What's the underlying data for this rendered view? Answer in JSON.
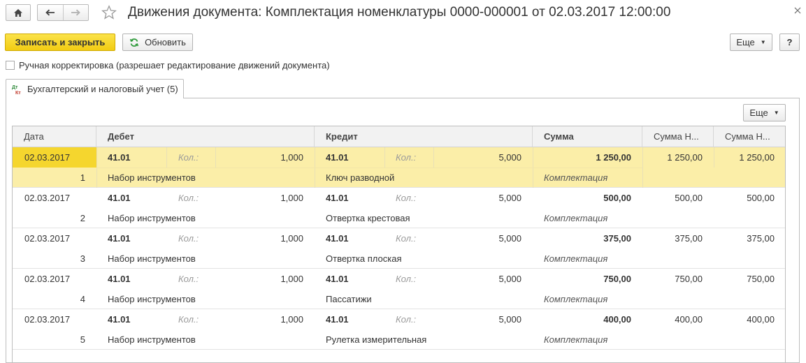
{
  "window": {
    "title": "Движения документа: Комплектация номенклатуры 0000-000001 от 02.03.2017 12:00:00"
  },
  "toolbar": {
    "save_close_label": "Записать и закрыть",
    "refresh_label": "Обновить",
    "more_label": "Еще",
    "help_label": "?"
  },
  "manual_edit": {
    "label": "Ручная корректировка (разрешает редактирование движений документа)",
    "checked": false
  },
  "tab": {
    "label": "Бухгалтерский и налоговый учет (5)"
  },
  "table": {
    "more_label": "Еще",
    "columns": [
      "Дата",
      "Дебет",
      "Кредит",
      "Сумма",
      "Сумма Н...",
      "Сумма Н..."
    ],
    "qty_label": "Кол.:",
    "rows": [
      {
        "date": "02.03.2017",
        "num": "1",
        "debit_acc": "41.01",
        "debit_qty": "1,000",
        "debit_item": "Набор инструментов",
        "credit_acc": "41.01",
        "credit_qty": "5,000",
        "credit_item": "Ключ разводной",
        "sum": "1 250,00",
        "content": "Комплектация",
        "sum_nu": "1 250,00",
        "sum_nu2": "1 250,00"
      },
      {
        "date": "02.03.2017",
        "num": "2",
        "debit_acc": "41.01",
        "debit_qty": "1,000",
        "debit_item": "Набор инструментов",
        "credit_acc": "41.01",
        "credit_qty": "5,000",
        "credit_item": "Отвертка крестовая",
        "sum": "500,00",
        "content": "Комплектация",
        "sum_nu": "500,00",
        "sum_nu2": "500,00"
      },
      {
        "date": "02.03.2017",
        "num": "3",
        "debit_acc": "41.01",
        "debit_qty": "1,000",
        "debit_item": "Набор инструментов",
        "credit_acc": "41.01",
        "credit_qty": "5,000",
        "credit_item": "Отвертка плоская",
        "sum": "375,00",
        "content": "Комплектация",
        "sum_nu": "375,00",
        "sum_nu2": "375,00"
      },
      {
        "date": "02.03.2017",
        "num": "4",
        "debit_acc": "41.01",
        "debit_qty": "1,000",
        "debit_item": "Набор инструментов",
        "credit_acc": "41.01",
        "credit_qty": "5,000",
        "credit_item": "Пассатижи",
        "sum": "750,00",
        "content": "Комплектация",
        "sum_nu": "750,00",
        "sum_nu2": "750,00"
      },
      {
        "date": "02.03.2017",
        "num": "5",
        "debit_acc": "41.01",
        "debit_qty": "1,000",
        "debit_item": "Набор инструментов",
        "credit_acc": "41.01",
        "credit_qty": "5,000",
        "credit_item": "Рулетка измерительная",
        "sum": "400,00",
        "content": "Комплектация",
        "sum_nu": "400,00",
        "sum_nu2": "400,00"
      }
    ]
  },
  "colors": {
    "accent": "#f2cc12",
    "selected_row": "#fbeea8",
    "selected_cell": "#f5d62e"
  },
  "icons": {
    "home": "home-icon",
    "back": "arrow-left-icon",
    "forward": "arrow-right-icon",
    "favorite": "star-icon",
    "close": "close-icon",
    "refresh": "refresh-icon",
    "tab": "dt-kt-icon"
  }
}
